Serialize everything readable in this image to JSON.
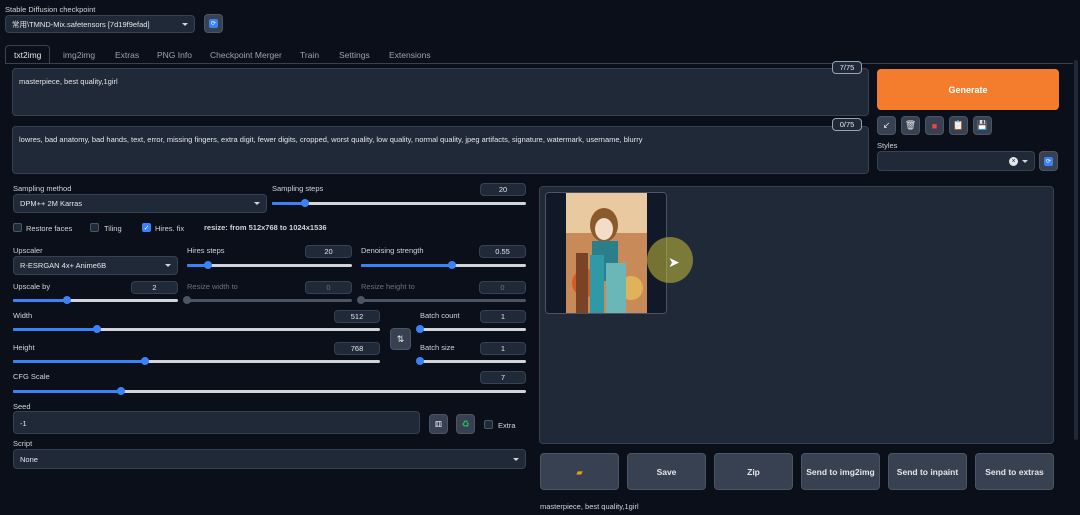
{
  "checkpoint": {
    "label": "Stable Diffusion checkpoint",
    "value": "常用\\TMND-Mix.safetensors [7d19f9efad]"
  },
  "tabs": [
    "txt2img",
    "img2img",
    "Extras",
    "PNG Info",
    "Checkpoint Merger",
    "Train",
    "Settings",
    "Extensions"
  ],
  "prompt": {
    "positive": "masterpiece, best quality,1girl",
    "positive_count": "7/75",
    "negative": "lowres, bad anatomy, bad hands, text, error, missing fingers, extra digit, fewer digits, cropped, worst quality, low quality, normal quality, jpeg artifacts, signature, watermark, username, blurry",
    "negative_count": "0/75"
  },
  "generate_label": "Generate",
  "styles_label": "Styles",
  "sampling": {
    "method_label": "Sampling method",
    "method_value": "DPM++ 2M Karras",
    "steps_label": "Sampling steps",
    "steps_value": "20"
  },
  "checks": {
    "restore_faces": "Restore faces",
    "tiling": "Tiling",
    "hires_fix": "Hires. fix",
    "resize_info": "resize: from 512x768 to 1024x1536"
  },
  "hires": {
    "upscaler_label": "Upscaler",
    "upscaler_value": "R-ESRGAN 4x+ Anime6B",
    "steps_label": "Hires steps",
    "steps_value": "20",
    "denoise_label": "Denoising strength",
    "denoise_value": "0.55",
    "upscale_by_label": "Upscale by",
    "upscale_by_value": "2",
    "resize_w_label": "Resize width to",
    "resize_w_value": "0",
    "resize_h_label": "Resize height to",
    "resize_h_value": "0"
  },
  "size": {
    "width_label": "Width",
    "width_value": "512",
    "height_label": "Height",
    "height_value": "768",
    "batch_count_label": "Batch count",
    "batch_count_value": "1",
    "batch_size_label": "Batch size",
    "batch_size_value": "1"
  },
  "cfg": {
    "label": "CFG Scale",
    "value": "7"
  },
  "seed": {
    "label": "Seed",
    "value": "-1",
    "extra_label": "Extra"
  },
  "script": {
    "label": "Script",
    "value": "None"
  },
  "output_buttons": {
    "folder": "",
    "save": "Save",
    "zip": "Zip",
    "send_img2img": "Send to img2img",
    "send_inpaint": "Send to inpaint",
    "send_extras": "Send to extras"
  },
  "output_caption": "masterpiece, best quality,1girl",
  "slider_levels": {
    "sampling_steps": 0.13,
    "hires_steps": 0.13,
    "denoise": 0.55,
    "upscale_by": 0.33,
    "width": 0.23,
    "height": 0.36,
    "batch_count": 0.0,
    "batch_size": 0.0,
    "cfg": 0.21
  },
  "colors": {
    "accent": "#3b82f6",
    "generate": "#f47c2d",
    "background": "#0b0f19",
    "panel": "#1f2937"
  }
}
